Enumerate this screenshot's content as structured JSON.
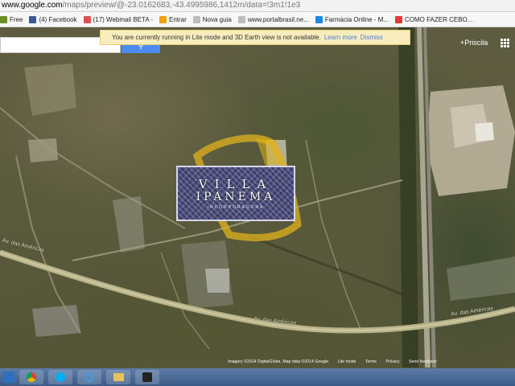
{
  "browser": {
    "url_host": "www.google.com",
    "url_rest": "/maps/preview/@-23.0162683,-43.4995986,1412m/data=!3m1!1e3",
    "bookmarks": [
      {
        "label": "Free",
        "icon": "bookmark-icon",
        "color": "#6b8e23"
      },
      {
        "label": "(4) Facebook",
        "icon": "facebook-icon",
        "color": "#3b5998"
      },
      {
        "label": "(17) Webmail BETA -",
        "icon": "webmail-icon",
        "color": "#d9534f"
      },
      {
        "label": "Entrar",
        "icon": "windows-icon",
        "color": "#f0a30a"
      },
      {
        "label": "Nova guia",
        "icon": "page-icon",
        "color": "#999999"
      },
      {
        "label": "www.portalbrasil.ne...",
        "icon": "page-icon",
        "color": "#999999"
      },
      {
        "label": "Farmácia Online - M...",
        "icon": "pharmacy-icon",
        "color": "#1e88e5"
      },
      {
        "label": "COMO FAZER CEBO...",
        "icon": "video-icon",
        "color": "#e53935"
      }
    ]
  },
  "maps": {
    "notice_text": "You are currently running in Lite mode and 3D Earth view is not available.",
    "notice_link_1": "Learn more",
    "notice_link_2": "Dismiss",
    "search_value": "",
    "user_name": "+Priscila",
    "road_label_1": "Av. das Américas",
    "road_label_2": "Av. das Américas",
    "road_label_3": "Av. das Américas",
    "attribution": [
      "Imagery ©2014 DigitalGlobe, Map data ©2014 Google",
      "Lite mode",
      "Terms",
      "Privacy",
      "Send feedback"
    ],
    "accent_color": "#4d8bf0",
    "highlight_color": "#e0b21c"
  },
  "overlay": {
    "logo_line_1": "VILLA",
    "logo_line_2": "IPANEMA",
    "logo_line_3": "INCORPORADORA"
  },
  "taskbar": {
    "items": [
      "windows-start-icon",
      "chrome-icon",
      "skype-icon",
      "ie-icon",
      "explorer-icon",
      "media-icon"
    ]
  }
}
